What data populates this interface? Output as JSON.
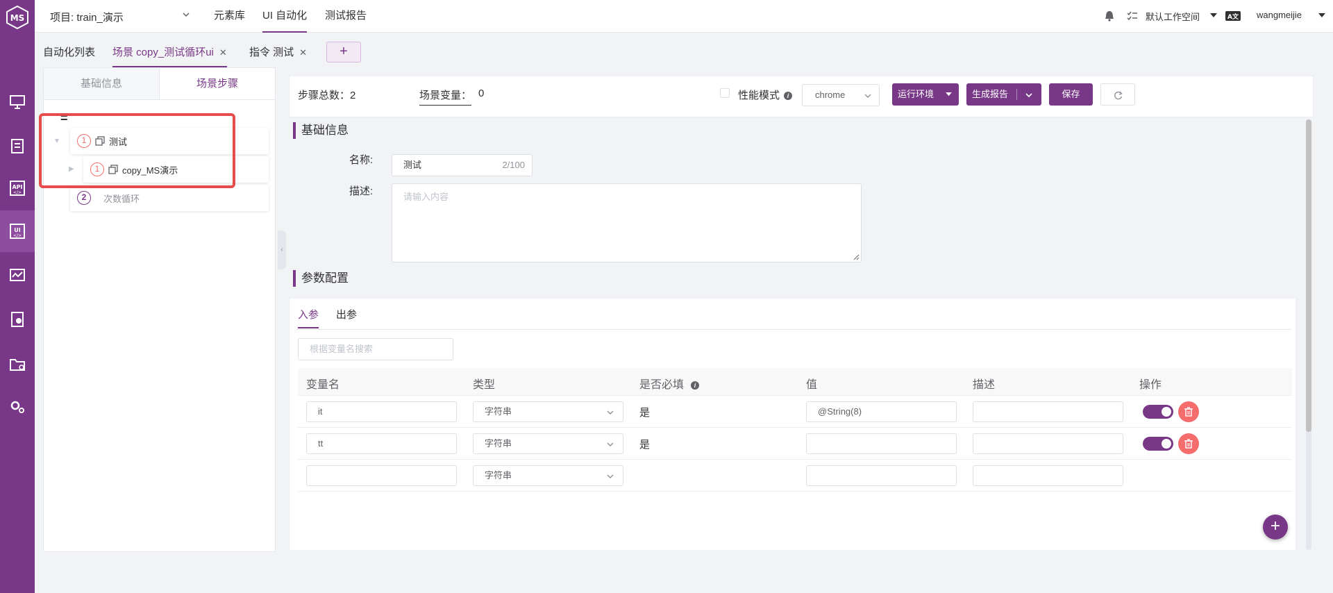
{
  "header": {
    "project_label": "项目: train_演示",
    "nav": [
      "元素库",
      "UI 自动化",
      "测试报告"
    ],
    "workspace": "默认工作空间",
    "user": "wangmeijie"
  },
  "tabs": {
    "list_label": "自动化列表",
    "scenario_tab": "场景 copy_测试循环ui",
    "command_tab": "指令 测试",
    "add": "+"
  },
  "left_panel": {
    "tabs": [
      "基础信息",
      "场景步骤"
    ],
    "drag_handle": "=",
    "nodes": [
      {
        "num": "1",
        "label": "测试"
      },
      {
        "num": "1",
        "label": "copy_MS演示"
      },
      {
        "num": "2",
        "label": "次数循环"
      }
    ]
  },
  "toolbar": {
    "step_total": "步骤总数：2",
    "scene_vars": "场景变量：",
    "scene_vars_count": "0",
    "perf_mode": "性能模式",
    "browser": "chrome",
    "run_env": "运行环境",
    "gen_report": "生成报告",
    "save": "保存"
  },
  "basic": {
    "title": "基础信息",
    "name_label": "名称:",
    "name_value": "测试",
    "name_count": "2/100",
    "desc_label": "描述:",
    "desc_placeholder": "请输入内容"
  },
  "params": {
    "title": "参数配置",
    "tabs": [
      "入参",
      "出参"
    ],
    "search_placeholder": "根据变量名搜索",
    "columns": [
      "变量名",
      "类型",
      "是否必填",
      "值",
      "描述",
      "操作"
    ],
    "rows": [
      {
        "name": "it",
        "type": "字符串",
        "required": "是",
        "value": "@String(8)",
        "desc": ""
      },
      {
        "name": "tt",
        "type": "字符串",
        "required": "是",
        "value": "",
        "desc": ""
      },
      {
        "name": "",
        "type": "字符串",
        "required": "",
        "value": "",
        "desc": ""
      }
    ],
    "fab": "+"
  },
  "colors": {
    "brand": "#783887",
    "danger": "#f56c6c",
    "highlight": "#e74c4c"
  }
}
